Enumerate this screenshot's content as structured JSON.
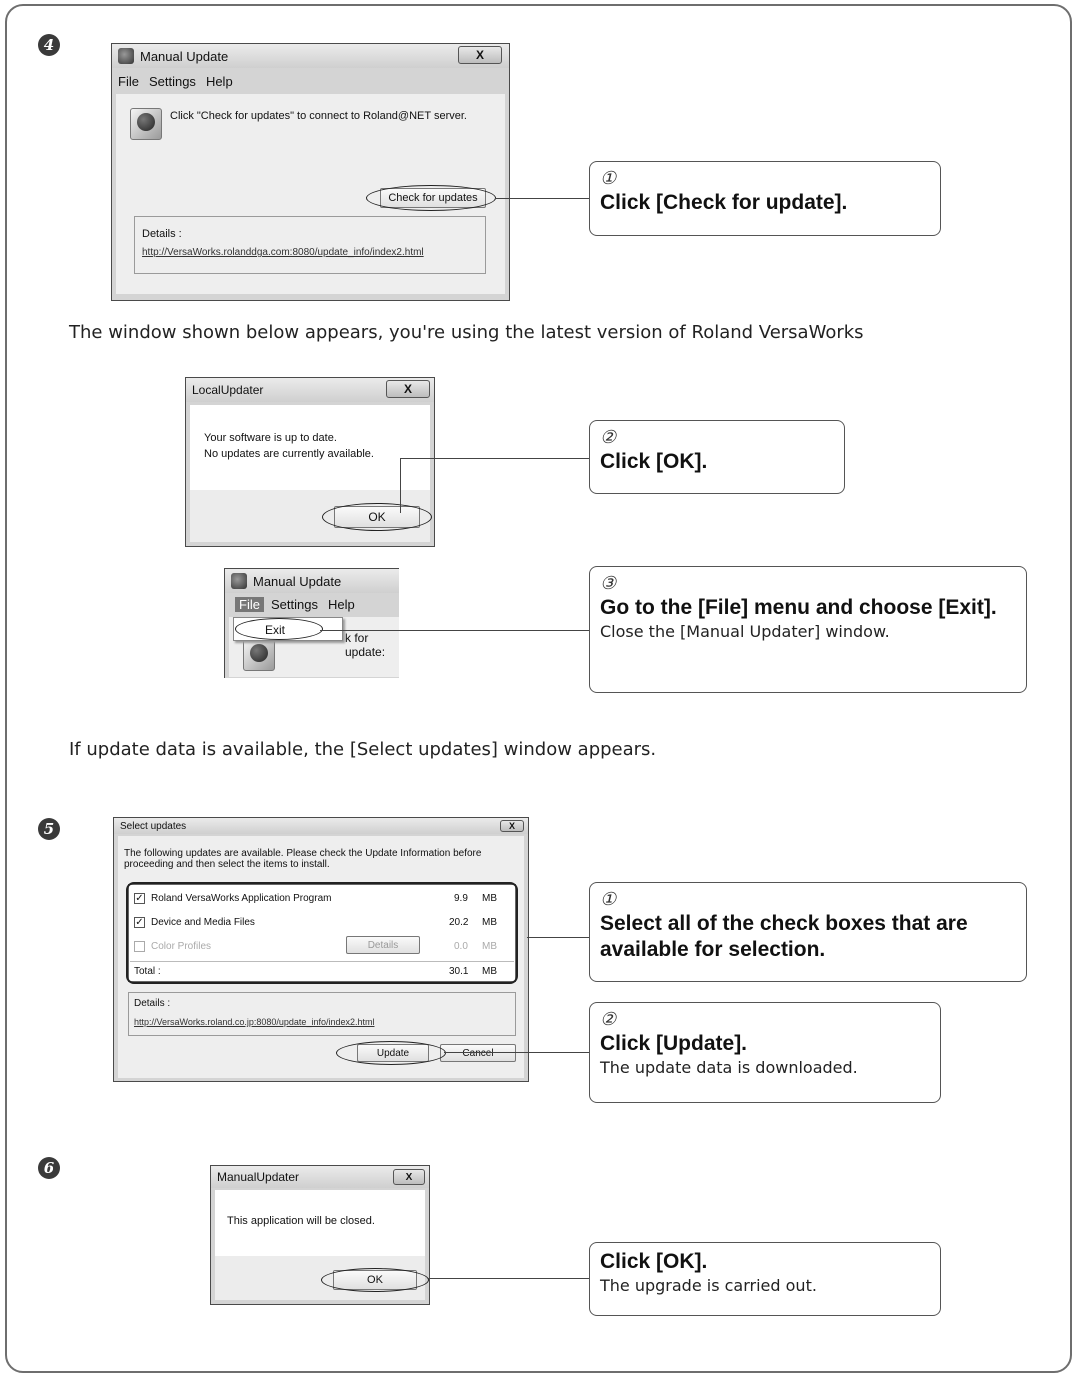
{
  "steps": {
    "s4": "4",
    "s5": "5",
    "s6": "6"
  },
  "manual_update_dialog": {
    "title": "Manual Update",
    "close": "X",
    "menu": [
      "File",
      "Settings",
      "Help"
    ],
    "message": "Click \"Check for updates\" to connect to Roland@NET server.",
    "check_button": "Check for updates",
    "details_label": "Details :",
    "details_link": "http://VersaWorks.rolanddga.com:8080/update_info/index2.html"
  },
  "callout_check": {
    "num": "①",
    "heading": "Click [Check for update]."
  },
  "para_latest": "The window shown below appears, you're using the latest version of Roland VersaWorks",
  "local_updater_dialog": {
    "title": "LocalUpdater",
    "close": "X",
    "line1": "Your software is up to date.",
    "line2": "No updates are currently available.",
    "ok": "OK"
  },
  "callout_ok1": {
    "num": "②",
    "heading": "Click [OK]."
  },
  "file_menu_snippet": {
    "title": "Manual Update",
    "menu": [
      "File",
      "Settings",
      "Help"
    ],
    "exit": "Exit",
    "partial": "k for update:"
  },
  "callout_exit": {
    "num": "③",
    "heading": "Go to the [File] menu and choose [Exit].",
    "note": "Close the [Manual Updater] window."
  },
  "para_available": "If update data is available, the [Select updates] window appears.",
  "select_updates_dialog": {
    "title": "Select updates",
    "close": "X",
    "intro_line1": "The following updates are available. Please check the Update Information before",
    "intro_line2": "proceeding and then select the items to install.",
    "items": [
      {
        "check": "✓",
        "name": "Roland VersaWorks Application Program",
        "size": "9.9",
        "unit": "MB"
      },
      {
        "check": "✓",
        "name": "Device and Media Files",
        "size": "20.2",
        "unit": "MB"
      },
      {
        "check": "",
        "name": "Color Profiles",
        "size": "0.0",
        "unit": "MB"
      }
    ],
    "details_button": "Details",
    "total_label": "Total :",
    "total_size": "30.1",
    "total_unit": "MB",
    "details_label": "Details :",
    "details_link": "http://VersaWorks.roland.co.jp:8080/update_info/index2.html",
    "update_button": "Update",
    "cancel_button": "Cancel"
  },
  "callout_select": {
    "num": "①",
    "heading": "Select all of the check boxes that are available for selection."
  },
  "callout_update": {
    "num": "②",
    "heading": "Click [Update].",
    "note": "The update data is downloaded."
  },
  "manual_updater_close_dialog": {
    "title": "ManualUpdater",
    "close": "X",
    "message": "This application will be closed.",
    "ok": "OK"
  },
  "callout_ok_final": {
    "heading": "Click [OK].",
    "note": "The upgrade is carried out."
  }
}
